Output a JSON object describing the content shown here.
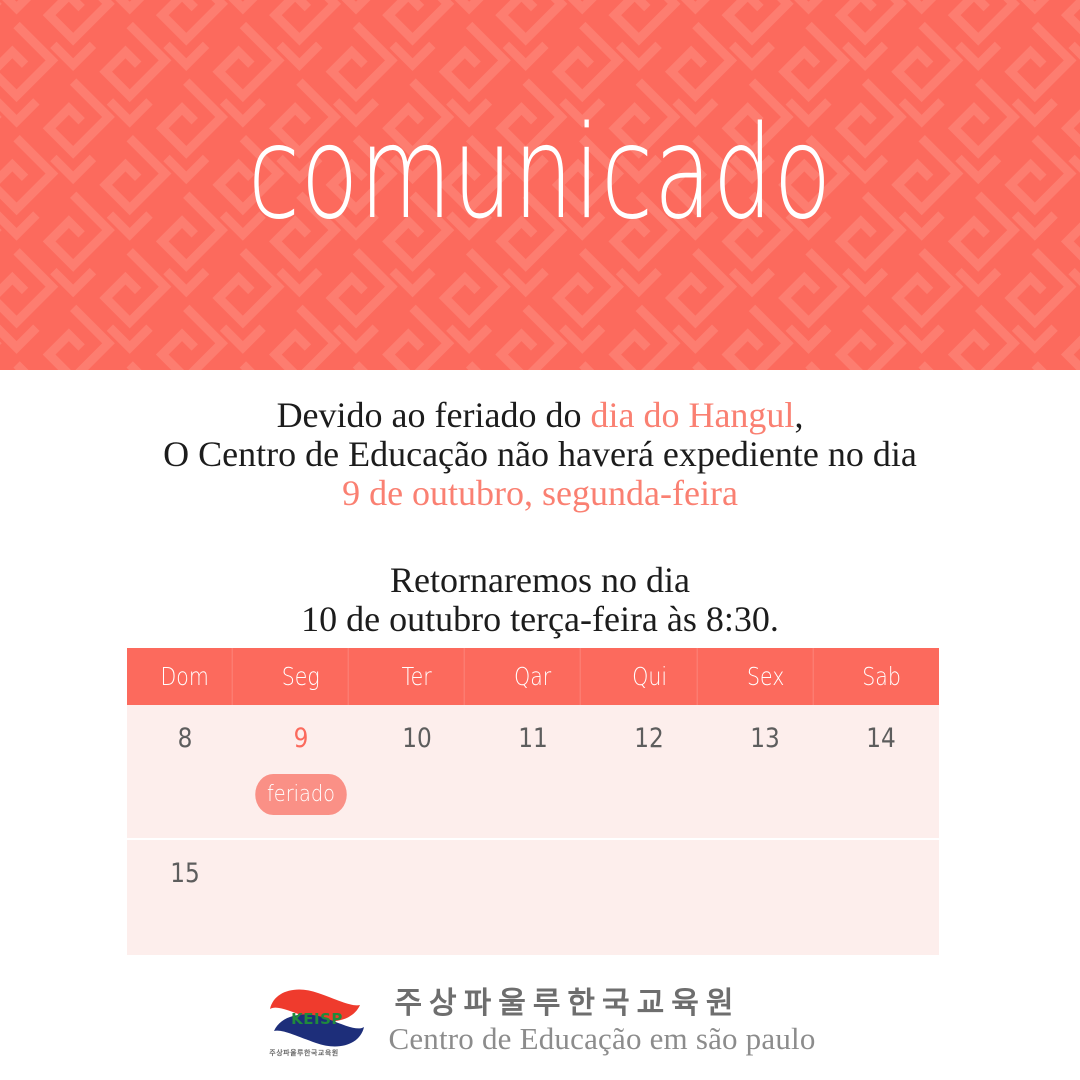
{
  "header": {
    "title": "comunicado",
    "background_color": "#fc6a5d",
    "pattern_color": "#fd7a6e",
    "title_color": "#ffffff"
  },
  "message": {
    "paragraph1": {
      "line1_part1": "Devido ao feriado do ",
      "line1_highlight": "dia do Hangul",
      "line1_part2": ",",
      "line2": "O Centro de Educação não haverá expediente no dia",
      "line3_highlight": "9 de outubro, segunda-feira"
    },
    "paragraph2": {
      "line1": "Retornaremos no dia",
      "line2": "10 de outubro terça-feira às 8:30."
    },
    "highlight_color": "#fa8072",
    "text_color": "#1c1c1c"
  },
  "calendar": {
    "weekday_headers": [
      "Dom",
      "Seg",
      "Ter",
      "Qar",
      "Qui",
      "Sex",
      "Sab"
    ],
    "header_background": "#fc6a5d",
    "body_background": "#fdeeec",
    "holiday_color": "#fb6a5d",
    "badge_color": "#fa9086",
    "rows": [
      {
        "cells": [
          {
            "day": "8",
            "holiday": false,
            "badge": ""
          },
          {
            "day": "9",
            "holiday": true,
            "badge": "feriado"
          },
          {
            "day": "10",
            "holiday": false,
            "badge": ""
          },
          {
            "day": "11",
            "holiday": false,
            "badge": ""
          },
          {
            "day": "12",
            "holiday": false,
            "badge": ""
          },
          {
            "day": "13",
            "holiday": false,
            "badge": ""
          },
          {
            "day": "14",
            "holiday": false,
            "badge": ""
          }
        ]
      },
      {
        "cells": [
          {
            "day": "15",
            "holiday": false,
            "badge": ""
          },
          {
            "day": "",
            "holiday": false,
            "badge": ""
          },
          {
            "day": "",
            "holiday": false,
            "badge": ""
          },
          {
            "day": "",
            "holiday": false,
            "badge": ""
          },
          {
            "day": "",
            "holiday": false,
            "badge": ""
          },
          {
            "day": "",
            "holiday": false,
            "badge": ""
          },
          {
            "day": "",
            "holiday": false,
            "badge": ""
          }
        ]
      }
    ]
  },
  "footer": {
    "logo_text": "KEISP",
    "logo_colors": {
      "top": "#ef3b2d",
      "bottom": "#1d2e7a",
      "text": "#1f8a3c"
    },
    "korean_name": "주상파울루한국교육원",
    "portuguese_name": "Centro de Educação em são paulo"
  }
}
